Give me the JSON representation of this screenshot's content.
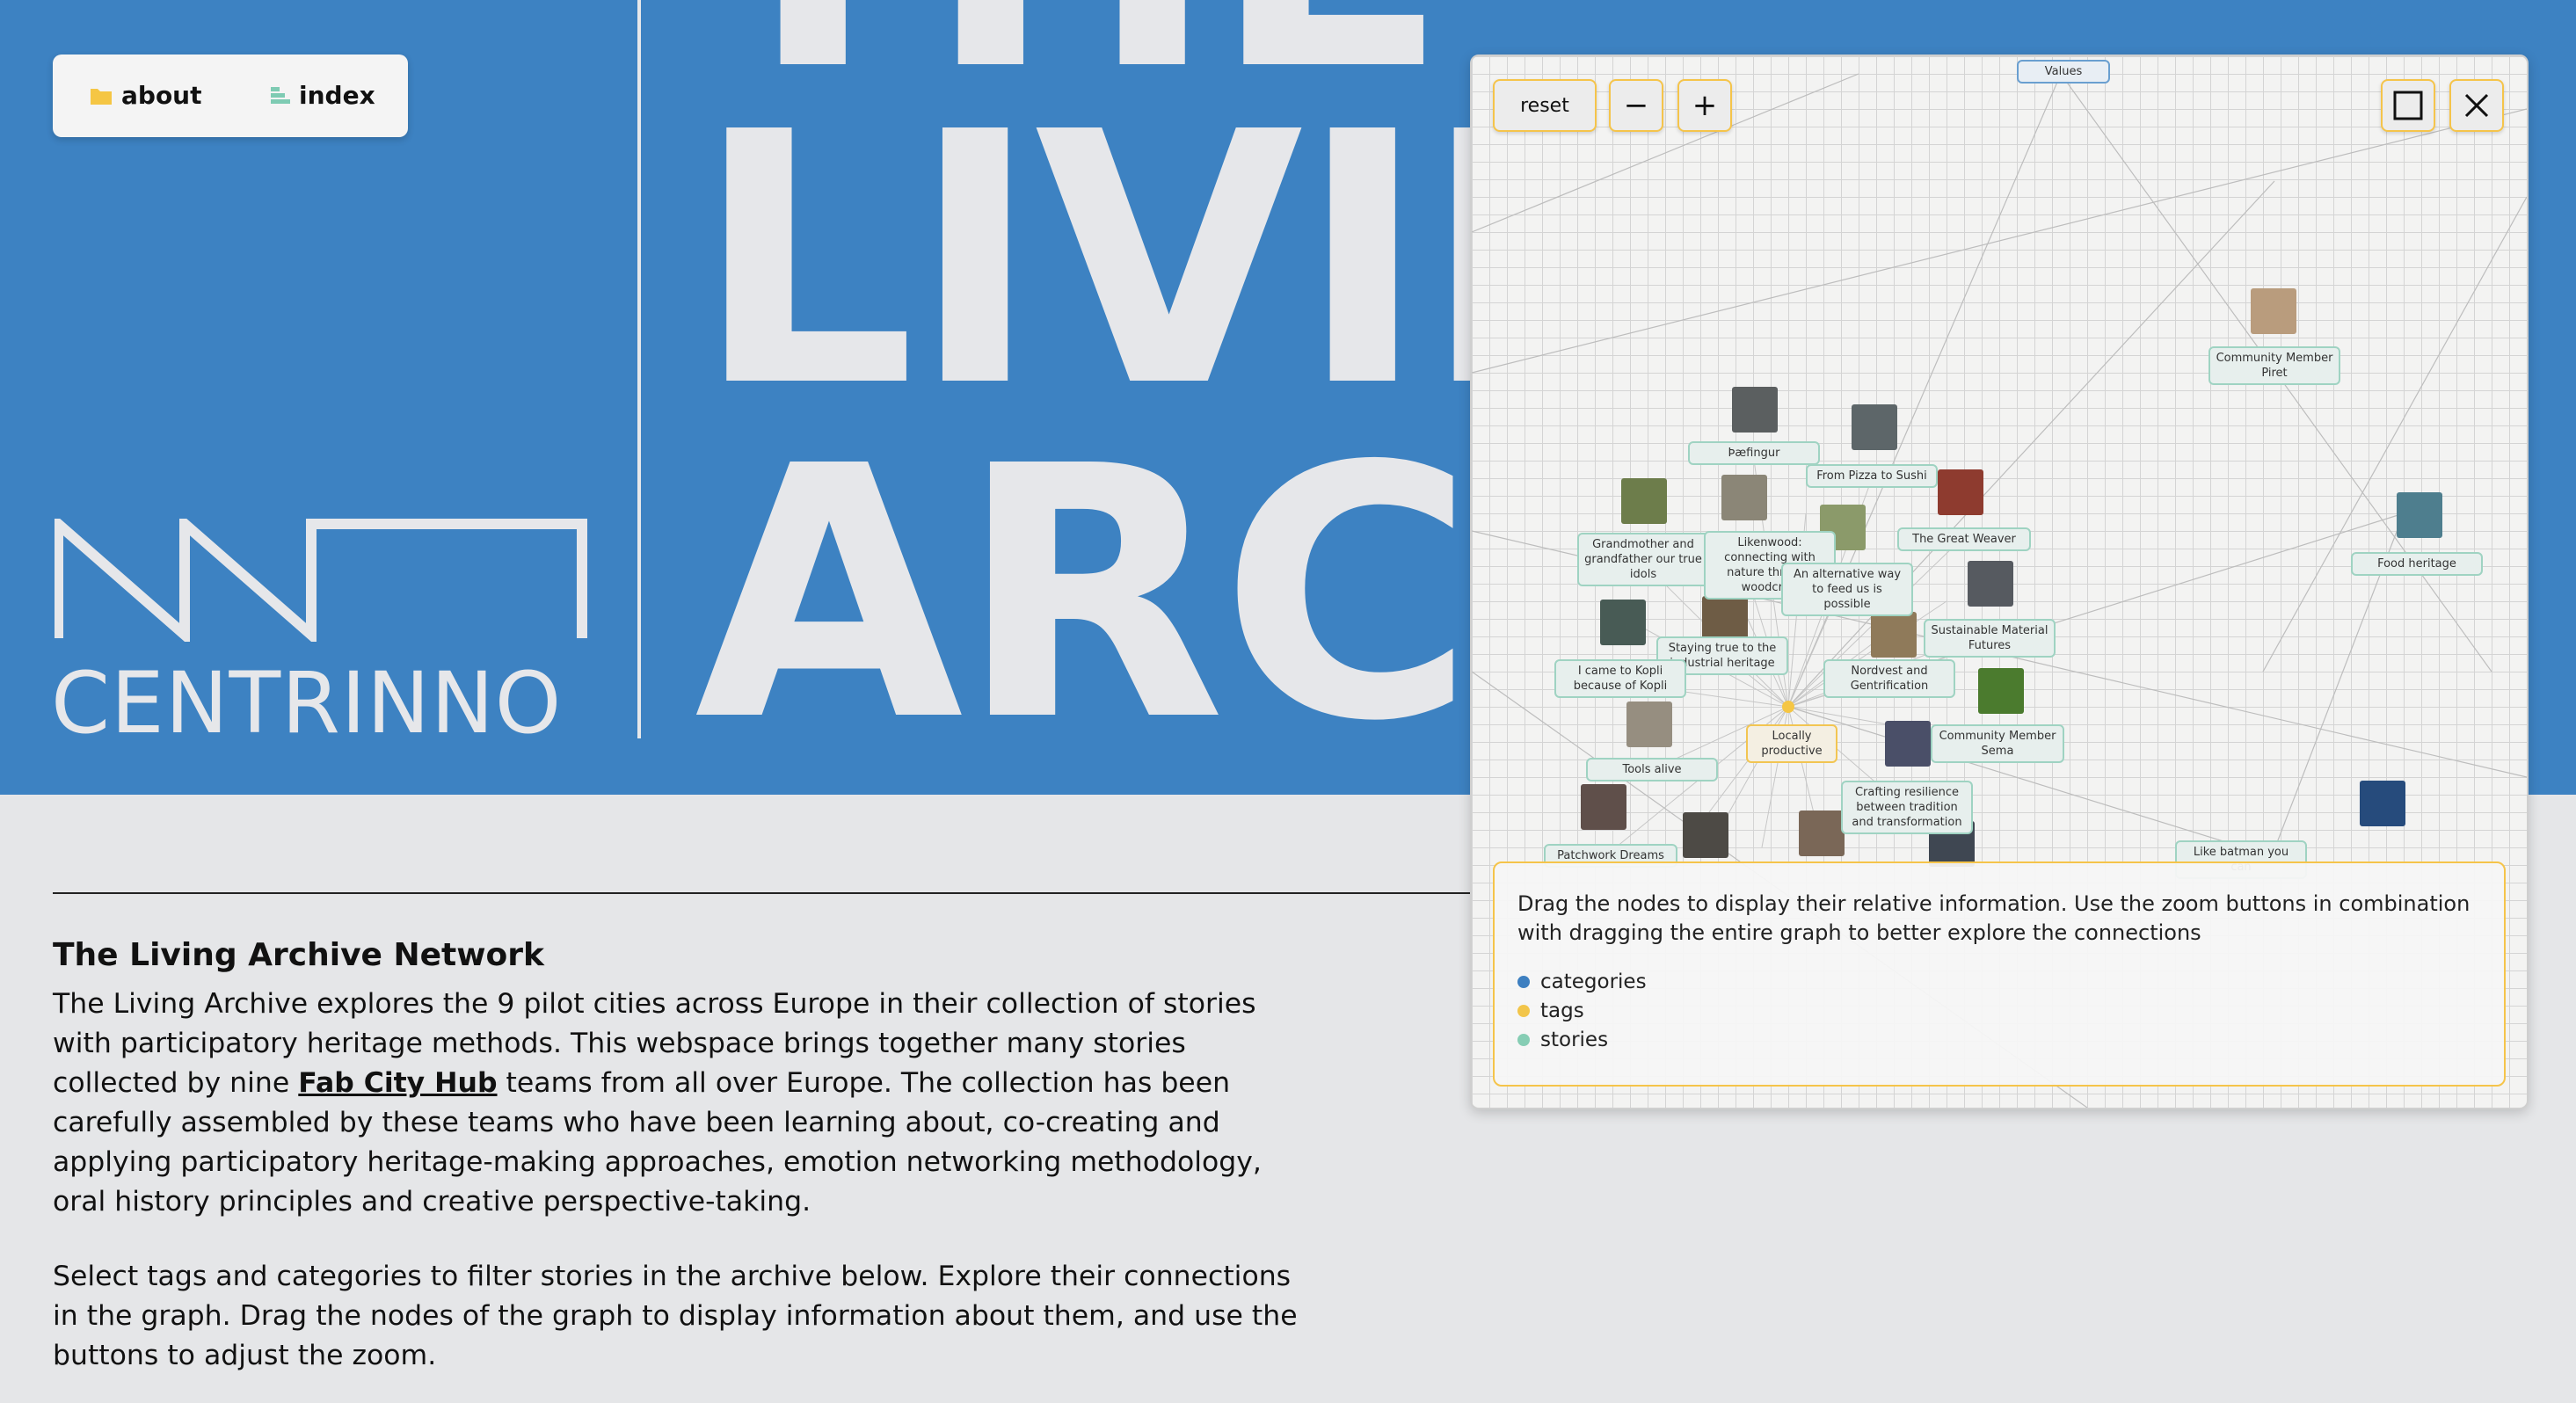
{
  "nav": {
    "about_label": "about",
    "index_label": "index",
    "about_icon": "folder-icon",
    "index_icon": "list-icon"
  },
  "hero": {
    "title_lines": [
      "THE",
      "LIVING",
      "ARCHIVE"
    ],
    "brand": "CENTRINNO",
    "bg_color": "#3d82c2"
  },
  "intro": {
    "heading": "The Living Archive Network",
    "para1_before": "The Living Archive explores the 9 pilot cities across Europe in their collection of stories with participatory heritage methods. This webspace brings together many stories collected by nine ",
    "para1_link": "Fab City Hub",
    "para1_after": " teams from all over Europe. The collection has been carefully assembled by these teams who have been learning about, co-creating and applying participatory heritage-making approaches, emotion networking methodology, oral history principles and creative perspective-taking.",
    "para2": "Select tags and categories to filter stories in the archive below. Explore their connections in the graph. Drag the nodes of the graph to display information about them, and use the buttons to adjust the zoom."
  },
  "graph": {
    "reset_label": "reset",
    "zoom_out_symbol": "−",
    "zoom_in_symbol": "+",
    "maximize_icon": "square-icon",
    "close_icon": "close-icon",
    "nodes": {
      "values": "Values",
      "community_piret": "Community Member Piret",
      "thaefingur": "Þæfingur",
      "pizza_sushi": "From Pizza to Sushi",
      "food_heritage": "Food heritage",
      "grandmother": "Grandmother and grandfather our true idols",
      "likenwood": "Likenwood: connecting with nature through woodcraft",
      "great_weaver": "The Great Weaver",
      "alternative_way": "An alternative way to feed us is possible",
      "sustainable_material": "Sustainable Material Futures",
      "staying_true": "Staying true to the industrial heritage",
      "came_to_kopli": "I came to Kopli because of Kopli",
      "nordvest": "Nordvest and Gentrification",
      "locally_productive": "Locally productive",
      "community_sema": "Community Member Sema",
      "tools_alive": "Tools alive",
      "crafting_resilience": "Crafting resilience between tradition and transformation",
      "patchwork_dreams": "Patchwork Dreams",
      "batman": "Like batman you can"
    },
    "info_text": "Drag the nodes to display their relative information. Use the zoom buttons in combination with dragging the entire graph to better explore the connections",
    "legend": [
      {
        "label": "categories",
        "color": "#3d7fc0"
      },
      {
        "label": "tags",
        "color": "#f2c54a"
      },
      {
        "label": "stories",
        "color": "#86cdb4"
      }
    ]
  }
}
